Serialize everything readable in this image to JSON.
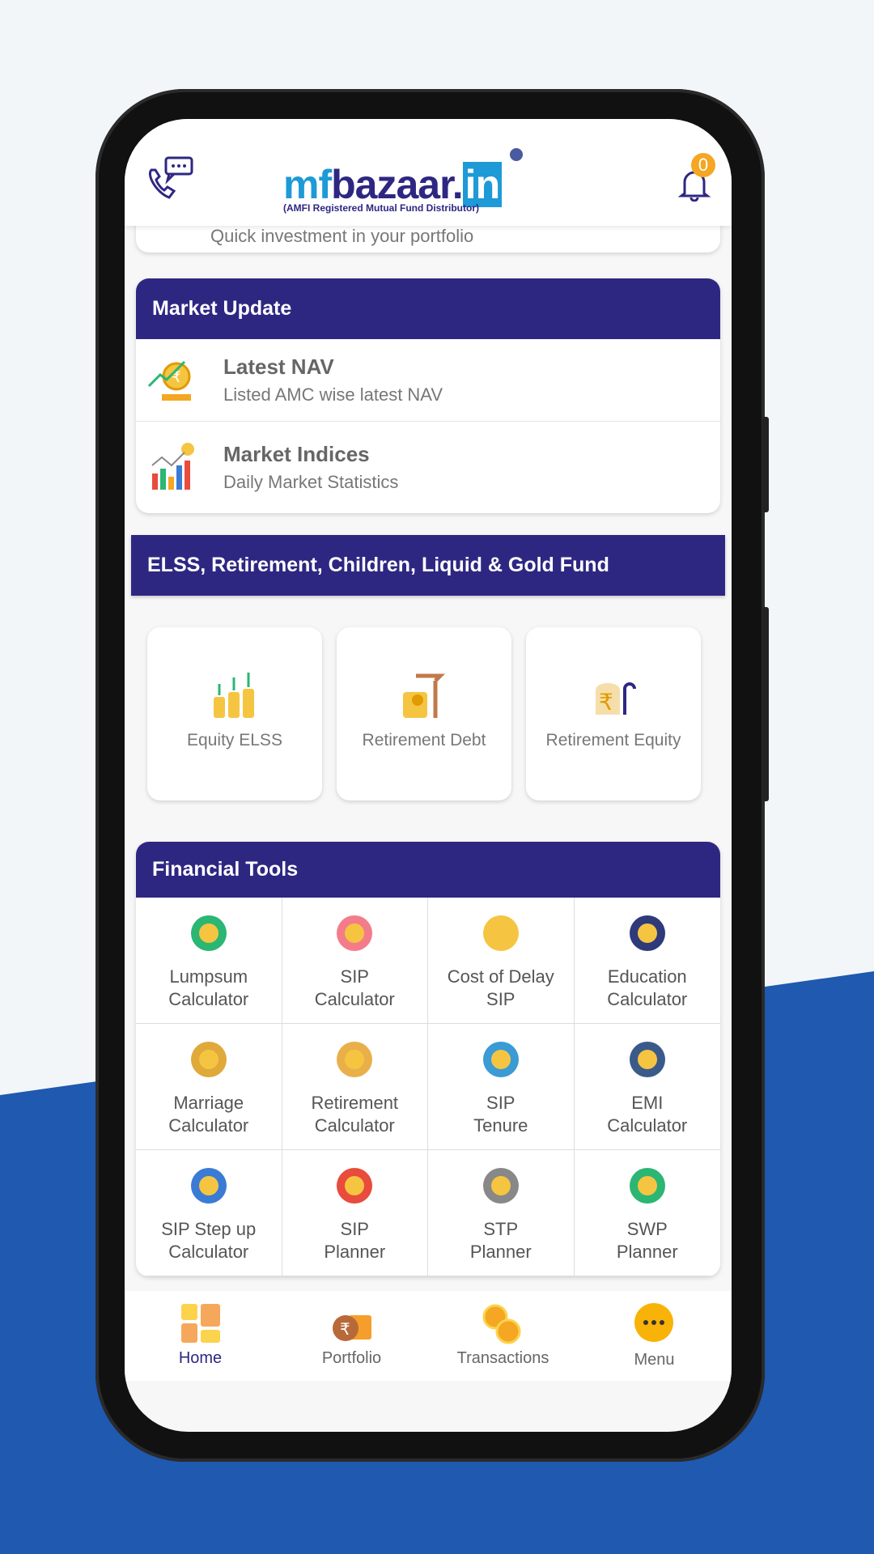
{
  "header": {
    "logo": "mfbazaar.in",
    "tagline": "(AMFI Registered Mutual Fund Distributor)",
    "notification_count": "0"
  },
  "partial_card": {
    "subtitle": "Quick investment in your portfolio"
  },
  "market_update": {
    "title": "Market Update",
    "items": [
      {
        "title": "Latest NAV",
        "subtitle": "Listed AMC wise latest NAV"
      },
      {
        "title": "Market Indices",
        "subtitle": "Daily Market Statistics"
      }
    ]
  },
  "funds": {
    "title": "ELSS, Retirement, Children, Liquid & Gold Fund",
    "tiles": [
      {
        "label": "Equity ELSS"
      },
      {
        "label": "Retirement Debt"
      },
      {
        "label": "Retirement Equity"
      }
    ]
  },
  "tools": {
    "title": "Financial Tools",
    "items": [
      {
        "label": "Lumpsum\nCalculator",
        "icon": "money-bag-icon"
      },
      {
        "label": "SIP\nCalculator",
        "icon": "piggy-bank-icon"
      },
      {
        "label": "Cost of Delay\nSIP",
        "icon": "coins-stack-icon"
      },
      {
        "label": "Education\nCalculator",
        "icon": "graduation-cap-icon"
      },
      {
        "label": "Marriage\nCalculator",
        "icon": "rings-icon"
      },
      {
        "label": "Retirement\nCalculator",
        "icon": "rocking-chair-icon"
      },
      {
        "label": "SIP\nTenure",
        "icon": "clock-rupee-icon"
      },
      {
        "label": "EMI\nCalculator",
        "icon": "calculator-icon"
      },
      {
        "label": "SIP Step up\nCalculator",
        "icon": "steps-icon"
      },
      {
        "label": "SIP\nPlanner",
        "icon": "growth-coins-icon"
      },
      {
        "label": "STP\nPlanner",
        "icon": "transfer-icon"
      },
      {
        "label": "SWP\nPlanner",
        "icon": "atm-icon"
      }
    ]
  },
  "nav": {
    "items": [
      {
        "label": "Home",
        "active": true
      },
      {
        "label": "Portfolio"
      },
      {
        "label": "Transactions"
      },
      {
        "label": "Menu"
      }
    ]
  },
  "colors": {
    "primary": "#2e2782",
    "accent": "#f5a623",
    "background_blue": "#1f59b0"
  }
}
